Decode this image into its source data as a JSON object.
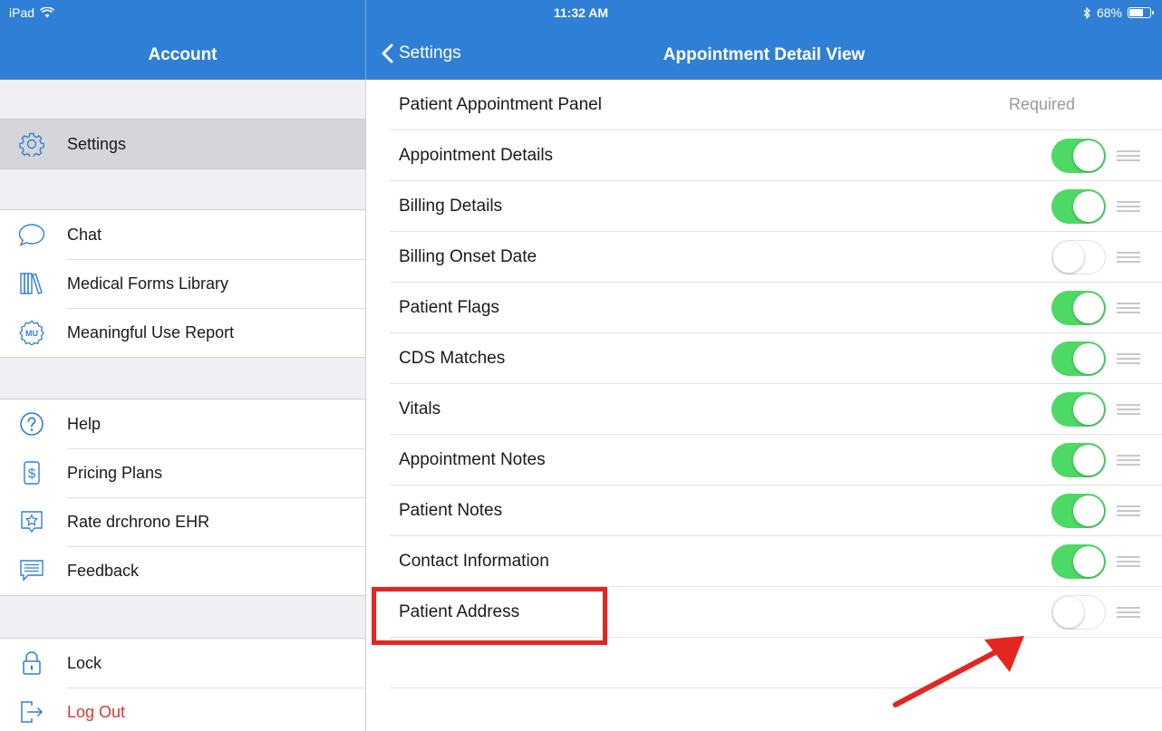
{
  "status": {
    "carrier": "iPad",
    "time": "11:32 AM",
    "battery": "68%",
    "battery_level": 0.68
  },
  "header": {
    "account_title": "Account",
    "back_label": "Settings",
    "page_title": "Appointment Detail View"
  },
  "sidebar": {
    "settings": {
      "label": "Settings",
      "icon": "gear-icon"
    },
    "group2": [
      {
        "label": "Chat",
        "icon": "chat-bubble-icon"
      },
      {
        "label": "Medical Forms Library",
        "icon": "library-books-icon"
      },
      {
        "label": "Meaningful Use Report",
        "icon": "mu-badge-icon",
        "badge_text": "MU"
      }
    ],
    "group3": [
      {
        "label": "Help",
        "icon": "help-icon"
      },
      {
        "label": "Pricing Plans",
        "icon": "dollar-icon"
      },
      {
        "label": "Rate drchrono EHR",
        "icon": "star-icon"
      },
      {
        "label": "Feedback",
        "icon": "feedback-icon"
      }
    ],
    "group4": [
      {
        "label": "Lock",
        "icon": "lock-icon"
      },
      {
        "label": "Log Out",
        "icon": "logout-icon"
      }
    ]
  },
  "main": {
    "rows": [
      {
        "label": "Patient Appointment Panel",
        "status": "Required"
      },
      {
        "label": "Appointment Details",
        "enabled": true
      },
      {
        "label": "Billing Details",
        "enabled": true
      },
      {
        "label": "Billing Onset Date",
        "enabled": false
      },
      {
        "label": "Patient Flags",
        "enabled": true
      },
      {
        "label": "CDS Matches",
        "enabled": true
      },
      {
        "label": "Vitals",
        "enabled": true
      },
      {
        "label": "Appointment Notes",
        "enabled": true
      },
      {
        "label": "Patient Notes",
        "enabled": true
      },
      {
        "label": "Contact Information",
        "enabled": true
      },
      {
        "label": "Patient Address",
        "enabled": false
      }
    ]
  },
  "colors": {
    "header": "#2f7fd6",
    "toggle_on": "#4cd964",
    "highlight": "#e52620",
    "logout": "#e0362c"
  }
}
